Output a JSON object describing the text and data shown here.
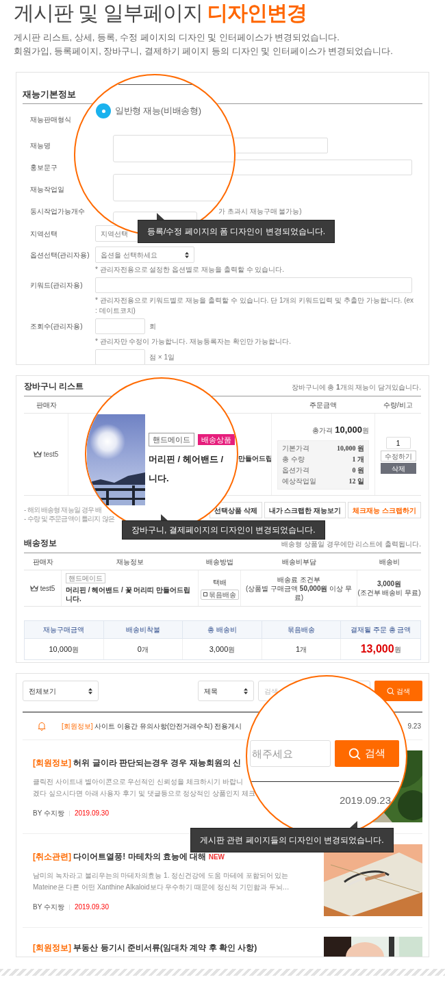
{
  "header": {
    "title": "게시판 및 일부페이지",
    "highlight": "디자인변경",
    "lines": [
      "게시판 리스트, 상세, 등록, 수정 페이지의 디자인 및 인터페이스가 변경되었습니다.",
      "회원가입, 등록페이지, 장바구니, 결제하기 페이지 등의 디자인 및 인터페이스가 변경되었습니다."
    ]
  },
  "form_panel": {
    "heading": "재능기본정보",
    "labels": [
      "재능판매형식",
      "재능명",
      "홍보문구",
      "재능작업일",
      "동시작업가능개수",
      "지역선택",
      "옵션선택(관리자용)",
      "키워드(관리자용)",
      "조회수(관리자용)"
    ],
    "concurrent_note": "가 초과시 재능구매 불가능)",
    "region_select": "지역선택",
    "option_select": "옵션을 선택하세요",
    "option_note": "* 관리자전용으로 설정한 옵션별로 재능을 출력할 수 있습니다.",
    "keyword_note": "* 관리자전용으로 키워드별로 재능을 출력할 수 있습니다. 단 1개의 키워드입력 및 추출만 가능합니다. (ex : 데이트코치)",
    "views_unit": "회",
    "views_note": "* 관리자만 수정이 가능합니다. 재능등록자는 확인만 가능합니다.",
    "score_unit": "점 × 1일",
    "magnifier": {
      "radio": {
        "label": "일반형 재능(비배송형)",
        "selected": true
      }
    },
    "callout": "등록/수정 페이지의 폼 디자인이 변경되었습니다."
  },
  "cart_panel": {
    "heading": "장바구니 리스트",
    "summary": "장바구니에 총 **1**개의 재능이 담겨있습니다.",
    "columns": [
      "판매자",
      "주문금액",
      "수량/비고"
    ],
    "item": {
      "seller": "test5",
      "title_tail": "만들어드립",
      "total_label": "총가격",
      "total": "10,000",
      "total_unit": "원",
      "breakdown": [
        {
          "label": "기본가격",
          "value": "10,000 원"
        },
        {
          "label": "총 수량",
          "value": "1 개"
        },
        {
          "label": "옵션가격",
          "value": "0 원"
        },
        {
          "label": "예상작업일",
          "value": "12 일"
        }
      ],
      "quantity": "1",
      "edit_button": "수정하기",
      "delete_button": "삭제"
    },
    "magnifier": {
      "tags": [
        {
          "label": "핸드메이드",
          "kind": "outline"
        },
        {
          "label": "배송상품",
          "kind": "filled"
        }
      ],
      "title_lines": [
        "머리핀 / 헤어밴드 /",
        "니다."
      ]
    },
    "notes": [
      "- 해외 배송형 재능일 경우 배",
      "- 수량 및 주문금액이 틀리지 않은"
    ],
    "buttons": [
      {
        "label": "선택상품 삭제",
        "kind": "default"
      },
      {
        "label": "내가 스크랩한 재능보기",
        "kind": "default"
      },
      {
        "label": "체크재능 스크랩하기",
        "kind": "accent"
      }
    ],
    "callout": "장바구니, 결제페이지의 디자인이 변경되었습니다.",
    "shipping": {
      "heading": "배송정보",
      "note": "배송형 상품일 경우에만 리스트에 출력됩니다.",
      "columns": [
        "판매자",
        "재능정보",
        "배송방법",
        "배송비부담",
        "배송비"
      ],
      "row": {
        "seller": "test5",
        "tag": "핸드메이드",
        "title": "머리핀 / 헤어밴드 / 꽃 머리띠 만들어드립니다.",
        "method": "택배",
        "bundle_button": "묶음배송",
        "fee_terms": "배송료 조건부",
        "fee_terms_detail": "(상품별 구매금액 **50,000원** 이상 무료)",
        "fee": "3,000원",
        "fee_detail": "(조건부 배송비 무료)"
      }
    },
    "totals": {
      "columns": [
        "재능구매금액",
        "배송비착불",
        "총 배송비",
        "묶음배송",
        "결재될 주문 총 금액"
      ],
      "values": [
        {
          "amount": "10,000",
          "unit": "원",
          "kind": "plain"
        },
        {
          "amount": "0",
          "unit": "개",
          "kind": "plain"
        },
        {
          "amount": "3,000",
          "unit": "원",
          "kind": "plain"
        },
        {
          "amount": "1",
          "unit": "개",
          "kind": "plain"
        },
        {
          "amount": "13,000",
          "unit": "원",
          "kind": "grand"
        }
      ]
    }
  },
  "board_panel": {
    "category_select": "전체보기",
    "field_select": "제목",
    "search_placeholder": "검색",
    "search_button": "검색",
    "notice": {
      "category": "[회원정보]",
      "title": "사이트 이용간 유의사항(안전거래수칙) 전용게시",
      "date": "9.23"
    },
    "posts": [
      {
        "category": "[회원정보]",
        "title": "허위 글이라 판단되는경우 경우 재능회원의 신",
        "excerpt": [
          "클릭전 사이트내 별아이콘으로 우선적인 신뢰성을 체크하시기 바랍니",
          "겠다 싶으시다면 아래 사용자 후기 및 댓글등으로 정상적인 상품인지 체크"
        ],
        "author": "BY 수지짱",
        "date": "2019.09.30"
      },
      {
        "category": "[취소관련]",
        "title": "다이어트열풍! 마테차의 효능에 대해",
        "badge": "NEW",
        "excerpt": [
          "남미의 녹차라고 불리우는의 마테차의효능 1. 정신건강에 도움 마테에 포함되어 있는",
          "Mateine은 다른 어떤 Xanthine Alkaloid보다 우수하기 때문에 정신적 기민함과 두뇌…"
        ],
        "author": "BY 수지짱",
        "date": "2019.09.30"
      },
      {
        "category": "[회원정보]",
        "title": "부동산 등기시 준비서류(임대차 계약 후 확인 사항)"
      }
    ],
    "magnifier": {
      "placeholder": "해주세요",
      "button": "검색",
      "date": "2019.09.23"
    },
    "callout": "게시판 관련 페이지들의 디자인이 변경되었습니다."
  }
}
